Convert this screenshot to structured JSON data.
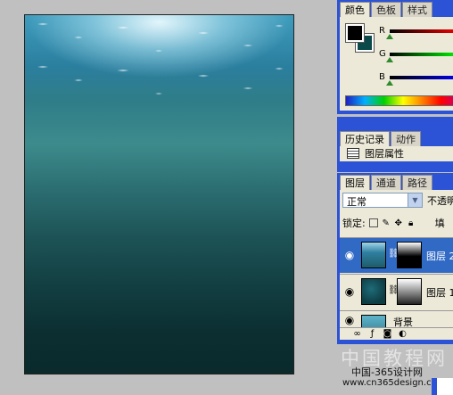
{
  "color_panel": {
    "tabs": [
      "颜色",
      "色板",
      "样式"
    ],
    "sliders": [
      {
        "label": "R",
        "value": 0
      },
      {
        "label": "G",
        "value": 0
      },
      {
        "label": "B",
        "value": 0
      }
    ],
    "foreground_color": "#000000",
    "background_color": "#0a4a4a"
  },
  "history_panel": {
    "tabs": [
      "历史记录",
      "动作"
    ],
    "items": [
      "图层属性"
    ]
  },
  "layers_panel": {
    "tabs": [
      "图层",
      "通道",
      "路径"
    ],
    "blend_mode": "正常",
    "opacity_label": "不透明",
    "lock_label": "锁定:",
    "fill_label": "填",
    "layers": [
      {
        "name": "图层 2",
        "visible": true,
        "selected": true
      },
      {
        "name": "图层 1",
        "visible": true,
        "selected": false
      },
      {
        "name": "背景",
        "visible": true,
        "selected": false
      }
    ]
  },
  "watermark": {
    "big": "中国教程网",
    "small": "中国-365设计网",
    "url": "www.cn365design.com"
  }
}
